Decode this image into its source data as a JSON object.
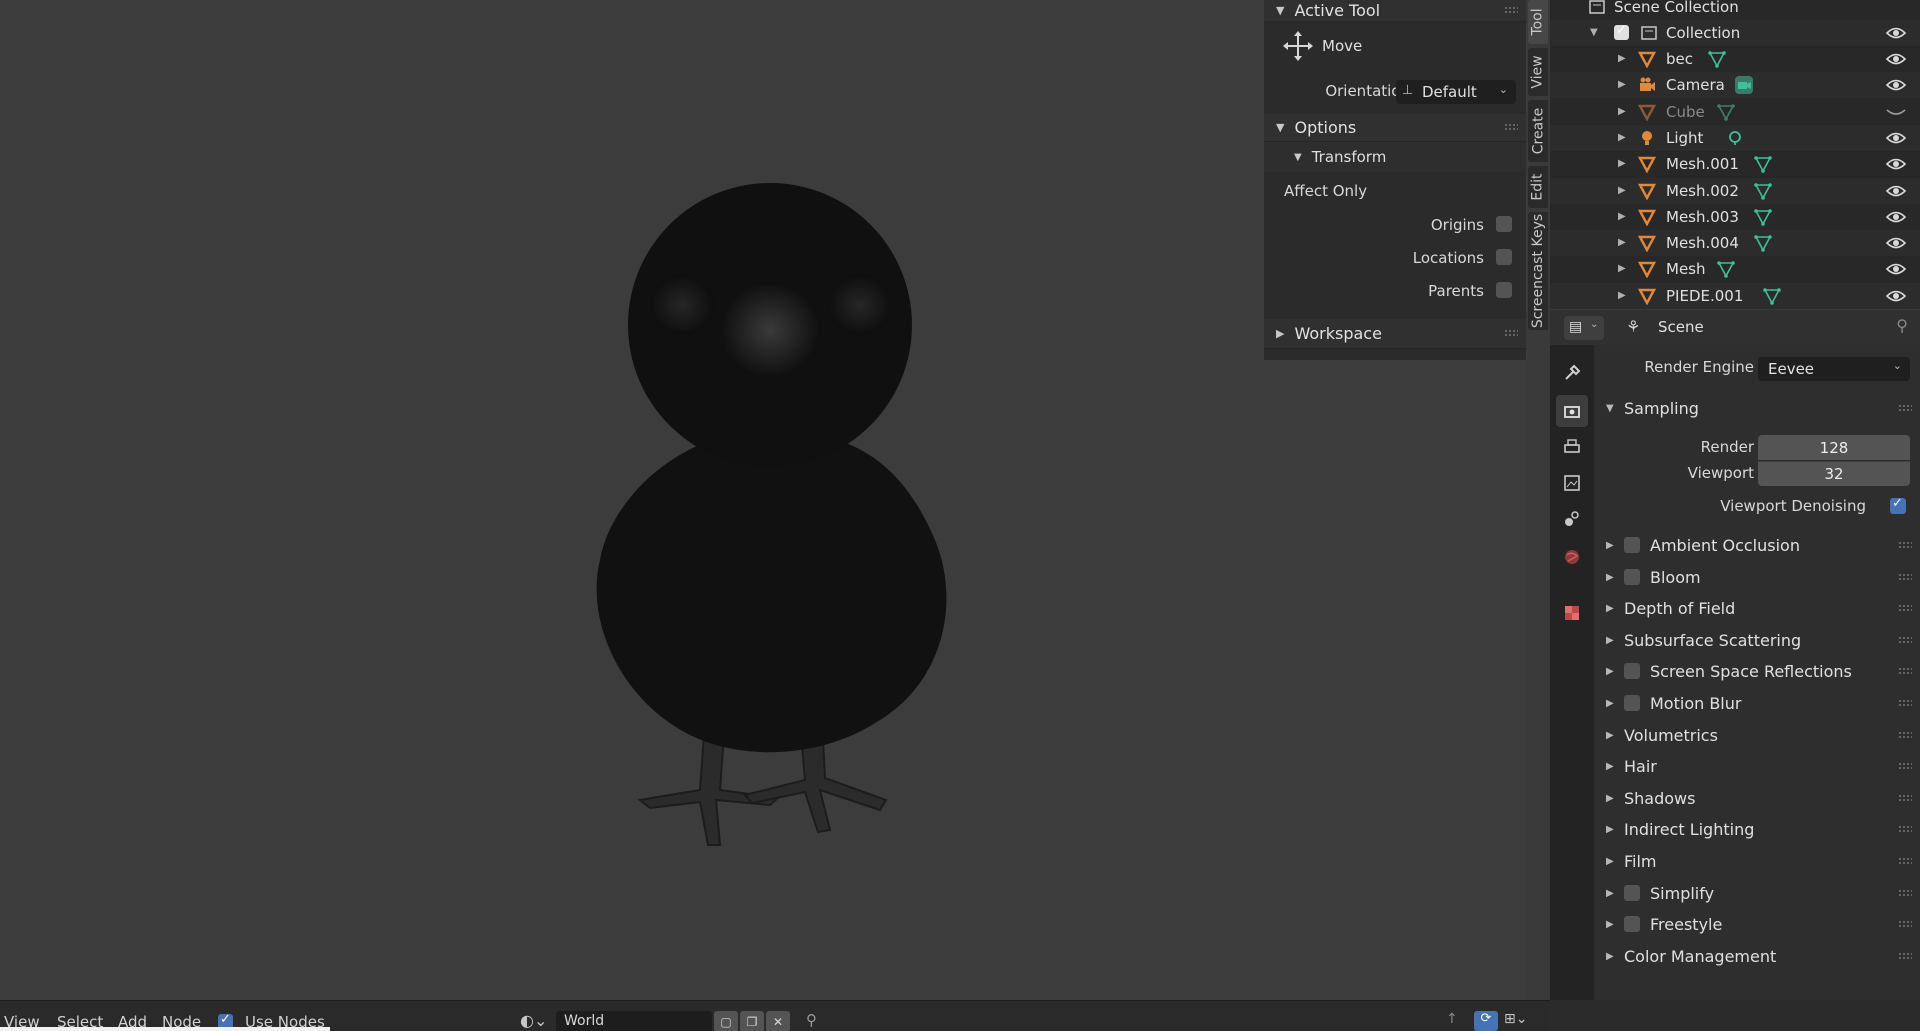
{
  "npanel": {
    "active_tool": "Active Tool",
    "tool_name": "Move",
    "orientation_label": "Orientation",
    "orientation_value": "Default",
    "options": "Options",
    "transform": "Transform",
    "affect_only": "Affect Only",
    "origins": "Origins",
    "locations": "Locations",
    "parents": "Parents",
    "workspace": "Workspace"
  },
  "vtabs": [
    "Tool",
    "View",
    "Create",
    "Edit",
    "Screencast Keys"
  ],
  "outliner": {
    "root": "Scene Collection",
    "collection": "Collection",
    "items": [
      {
        "name": "bec",
        "type": "mesh",
        "visible": true
      },
      {
        "name": "Camera",
        "type": "camera",
        "visible": true
      },
      {
        "name": "Cube",
        "type": "mesh",
        "visible": false
      },
      {
        "name": "Light",
        "type": "light",
        "visible": true
      },
      {
        "name": "Mesh.001",
        "type": "mesh",
        "visible": true
      },
      {
        "name": "Mesh.002",
        "type": "mesh",
        "visible": true
      },
      {
        "name": "Mesh.003",
        "type": "mesh",
        "visible": true
      },
      {
        "name": "Mesh.004",
        "type": "mesh",
        "visible": true
      },
      {
        "name": "Mesh",
        "type": "mesh",
        "visible": true
      },
      {
        "name": "PIEDE.001",
        "type": "mesh",
        "visible": true
      }
    ]
  },
  "properties": {
    "context": "Scene",
    "render_engine_label": "Render Engine",
    "render_engine_value": "Eevee",
    "sampling": "Sampling",
    "render_label": "Render",
    "render_value": "128",
    "viewport_label": "Viewport",
    "viewport_value": "32",
    "viewport_denoising": "Viewport Denoising",
    "sections": [
      {
        "label": "Ambient Occlusion",
        "checkbox": true
      },
      {
        "label": "Bloom",
        "checkbox": true
      },
      {
        "label": "Depth of Field",
        "checkbox": false
      },
      {
        "label": "Subsurface Scattering",
        "checkbox": false
      },
      {
        "label": "Screen Space Reflections",
        "checkbox": true
      },
      {
        "label": "Motion Blur",
        "checkbox": true
      },
      {
        "label": "Volumetrics",
        "checkbox": false
      },
      {
        "label": "Hair",
        "checkbox": false
      },
      {
        "label": "Shadows",
        "checkbox": false
      },
      {
        "label": "Indirect Lighting",
        "checkbox": false
      },
      {
        "label": "Film",
        "checkbox": false
      },
      {
        "label": "Simplify",
        "checkbox": true
      },
      {
        "label": "Freestyle",
        "checkbox": true
      },
      {
        "label": "Color Management",
        "checkbox": false
      }
    ]
  },
  "bottombar": {
    "view": "View",
    "select": "Select",
    "add": "Add",
    "node": "Node",
    "use_nodes": "Use Nodes",
    "world": "World"
  },
  "colors": {
    "accent": "#4772b3",
    "mesh_icon": "#e0883c",
    "data_icon": "#3fbf9a"
  }
}
